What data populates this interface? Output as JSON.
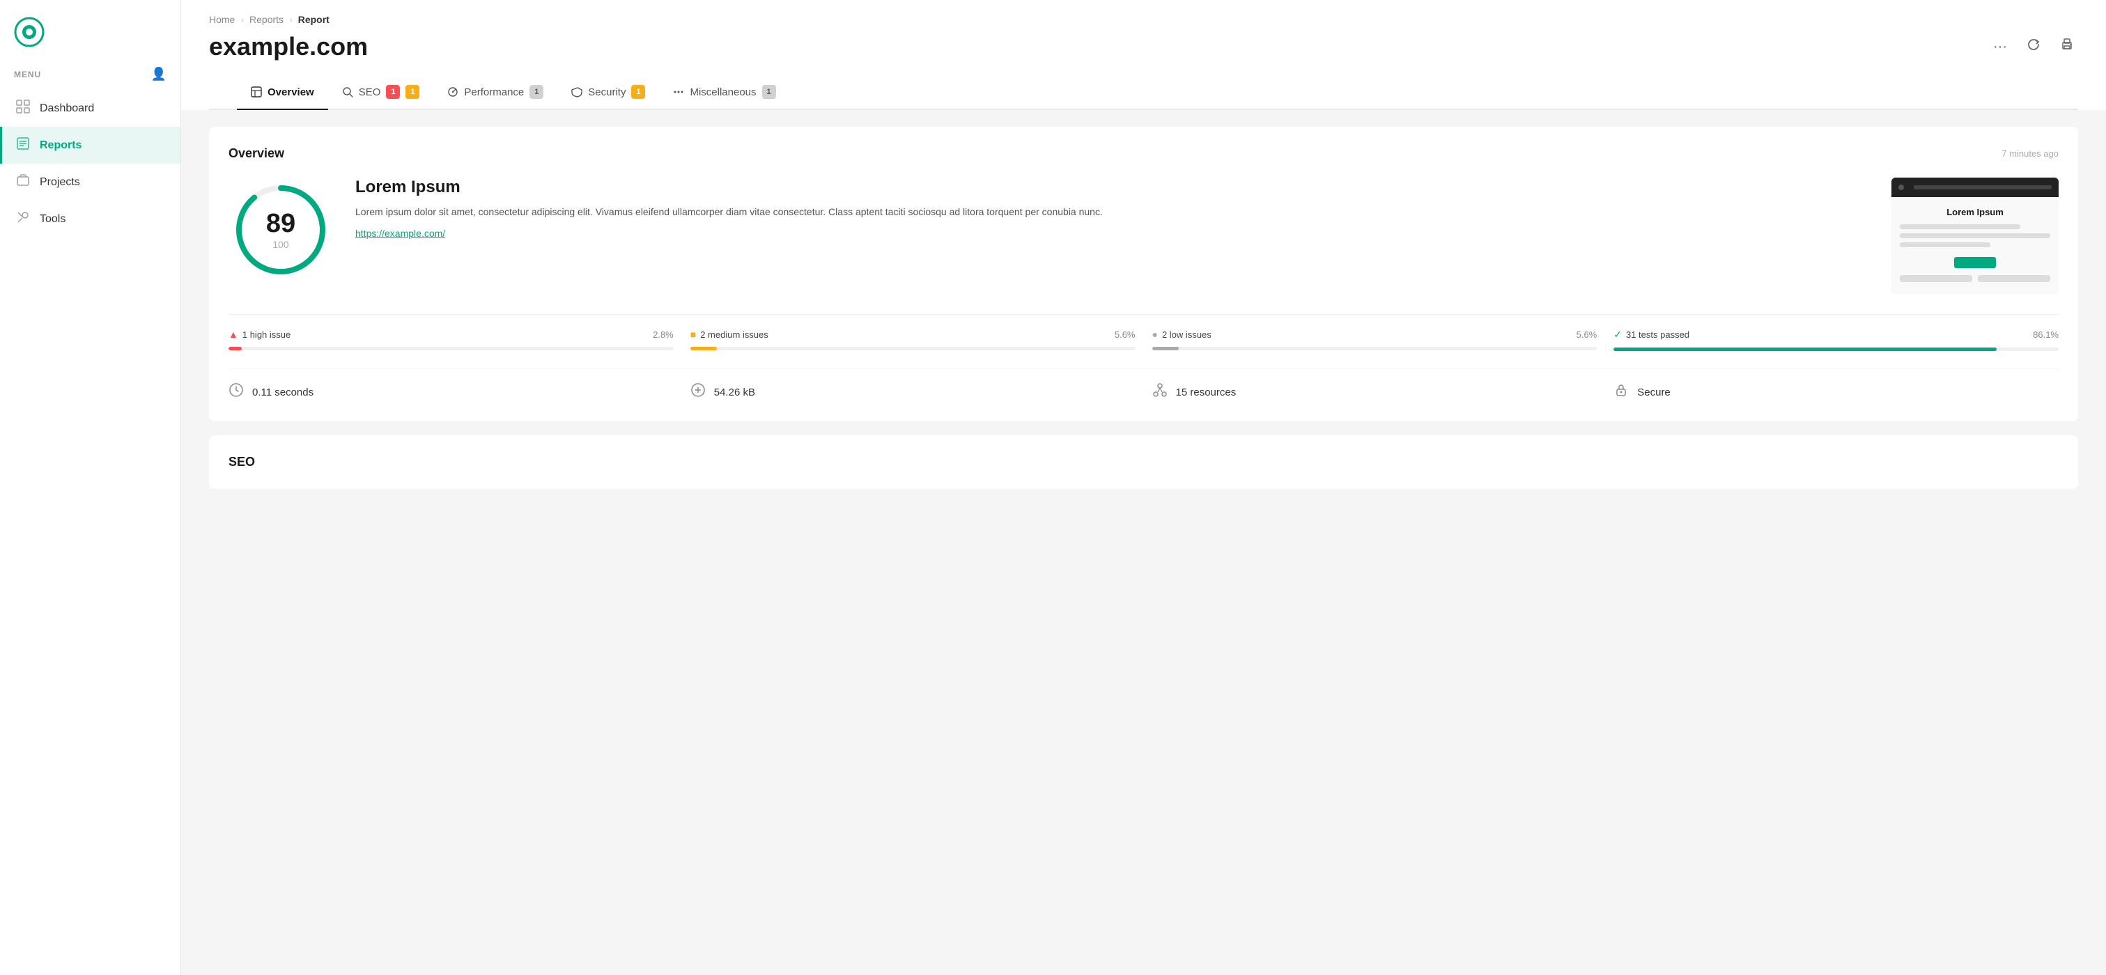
{
  "sidebar": {
    "menu_label": "MENU",
    "nav_items": [
      {
        "id": "dashboard",
        "label": "Dashboard",
        "icon": "⊞",
        "active": false
      },
      {
        "id": "reports",
        "label": "Reports",
        "icon": "☰",
        "active": true
      },
      {
        "id": "projects",
        "label": "Projects",
        "icon": "◫",
        "active": false
      },
      {
        "id": "tools",
        "label": "Tools",
        "icon": "✕",
        "active": false
      }
    ]
  },
  "breadcrumb": {
    "home": "Home",
    "reports": "Reports",
    "current": "Report"
  },
  "page": {
    "title": "example.com"
  },
  "header_actions": {
    "more": "···",
    "refresh": "↻",
    "print": "⎙"
  },
  "tabs": [
    {
      "id": "overview",
      "label": "Overview",
      "badge": null,
      "active": true
    },
    {
      "id": "seo",
      "label": "SEO",
      "badges": [
        "1",
        "1"
      ],
      "badge_colors": [
        "red",
        "yellow"
      ],
      "active": false
    },
    {
      "id": "performance",
      "label": "Performance",
      "badge": "1",
      "badge_color": "gray",
      "active": false
    },
    {
      "id": "security",
      "label": "Security",
      "badge": "1",
      "badge_color": "yellow",
      "active": false
    },
    {
      "id": "miscellaneous",
      "label": "Miscellaneous",
      "badge": "1",
      "badge_color": "gray",
      "active": false
    }
  ],
  "overview": {
    "title": "Overview",
    "timestamp": "7 minutes ago",
    "score": {
      "value": "89",
      "max": "100",
      "percent": 89
    },
    "site": {
      "title": "Lorem Ipsum",
      "description": "Lorem ipsum dolor sit amet, consectetur adipiscing elit. Vivamus eleifend ullamcorper diam vitae consectetur. Class aptent taciti sociosqu ad litora torquent per conubia nunc.",
      "url": "https://example.com/"
    },
    "thumbnail": {
      "title": "Lorem Ipsum",
      "button_label": ""
    },
    "issues": [
      {
        "id": "high",
        "label": "1 high issue",
        "pct": "2.8%",
        "color": "red",
        "fill_pct": 3
      },
      {
        "id": "medium",
        "label": "2 medium issues",
        "pct": "5.6%",
        "color": "yellow",
        "fill_pct": 6
      },
      {
        "id": "low",
        "label": "2 low issues",
        "pct": "5.6%",
        "color": "gray",
        "fill_pct": 6
      },
      {
        "id": "passed",
        "label": "31 tests passed",
        "pct": "86.1%",
        "color": "green",
        "fill_pct": 86
      }
    ],
    "stats": [
      {
        "id": "time",
        "icon": "⏱",
        "label": "0.11 seconds"
      },
      {
        "id": "size",
        "icon": "⚖",
        "label": "54.26 kB"
      },
      {
        "id": "resources",
        "icon": "⚙",
        "label": "15 resources"
      },
      {
        "id": "secure",
        "icon": "🔒",
        "label": "Secure"
      }
    ]
  },
  "seo_section": {
    "title": "SEO"
  }
}
